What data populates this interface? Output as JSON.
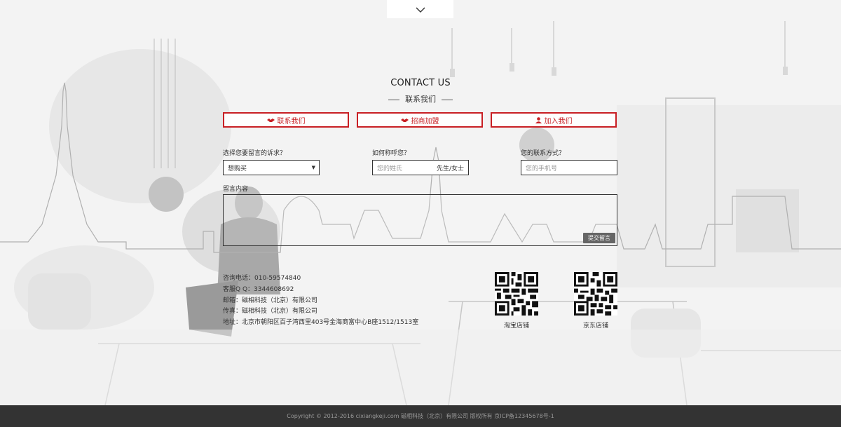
{
  "section": {
    "title_en": "CONTACT US",
    "title_cn": "联系我们"
  },
  "tabs": [
    {
      "label": "联系我们",
      "icon": "handshake-icon"
    },
    {
      "label": "招商加盟",
      "icon": "handshake-icon"
    },
    {
      "label": "加入我们",
      "icon": "user-icon"
    }
  ],
  "form": {
    "request_label": "选择您要留言的诉求？",
    "request_value": "想购买",
    "name_label": "如何称呼您？",
    "name_placeholder": "您的姓氏",
    "gender_value": "先生/女士",
    "contact_label": "您的联系方式？",
    "phone_placeholder": "您的手机号",
    "message_label": "留言内容",
    "submit_label": "提交留言"
  },
  "contact": {
    "phone": "咨询电话：010-59574840",
    "qq": "客服Q Q：3344608692",
    "email": "邮箱：磁相科技（北京）有限公司",
    "fax": "传真：磁相科技（北京）有限公司",
    "address": "地址：北京市朝阳区百子湾西里403号金海商富中心B座1512/1513室"
  },
  "qr": [
    {
      "label": "淘宝店铺"
    },
    {
      "label": "京东店铺"
    }
  ],
  "footer": {
    "copyright": "Copyright © 2012-2016 cixiangkeji.com 磁相科技（北京）有限公司 版权所有 京ICP备12345678号-1"
  },
  "colors": {
    "accent": "#c81f24",
    "footer_bg": "#333333"
  }
}
